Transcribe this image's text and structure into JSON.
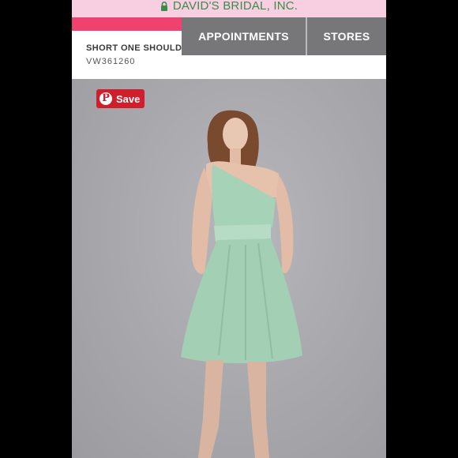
{
  "browser": {
    "url": "DAVID'S BRIDAL, INC.",
    "lock_icon": "lock-icon"
  },
  "nav": {
    "appointments": "APPOINTMENTS",
    "stores": "STORES"
  },
  "product": {
    "name": "SHORT ONE SHOULDER",
    "sku": "VW361260"
  },
  "pinterest": {
    "save_label": "Save",
    "icon": "pinterest-icon"
  },
  "colors": {
    "url_bar_bg": "#f7cfe0",
    "url_text": "#3d8a4a",
    "accent_pink": "#f0426f",
    "nav_button_bg": "#77777a",
    "pinterest_red": "#cf1f2c",
    "dress_mint": "#a6d2b8"
  }
}
